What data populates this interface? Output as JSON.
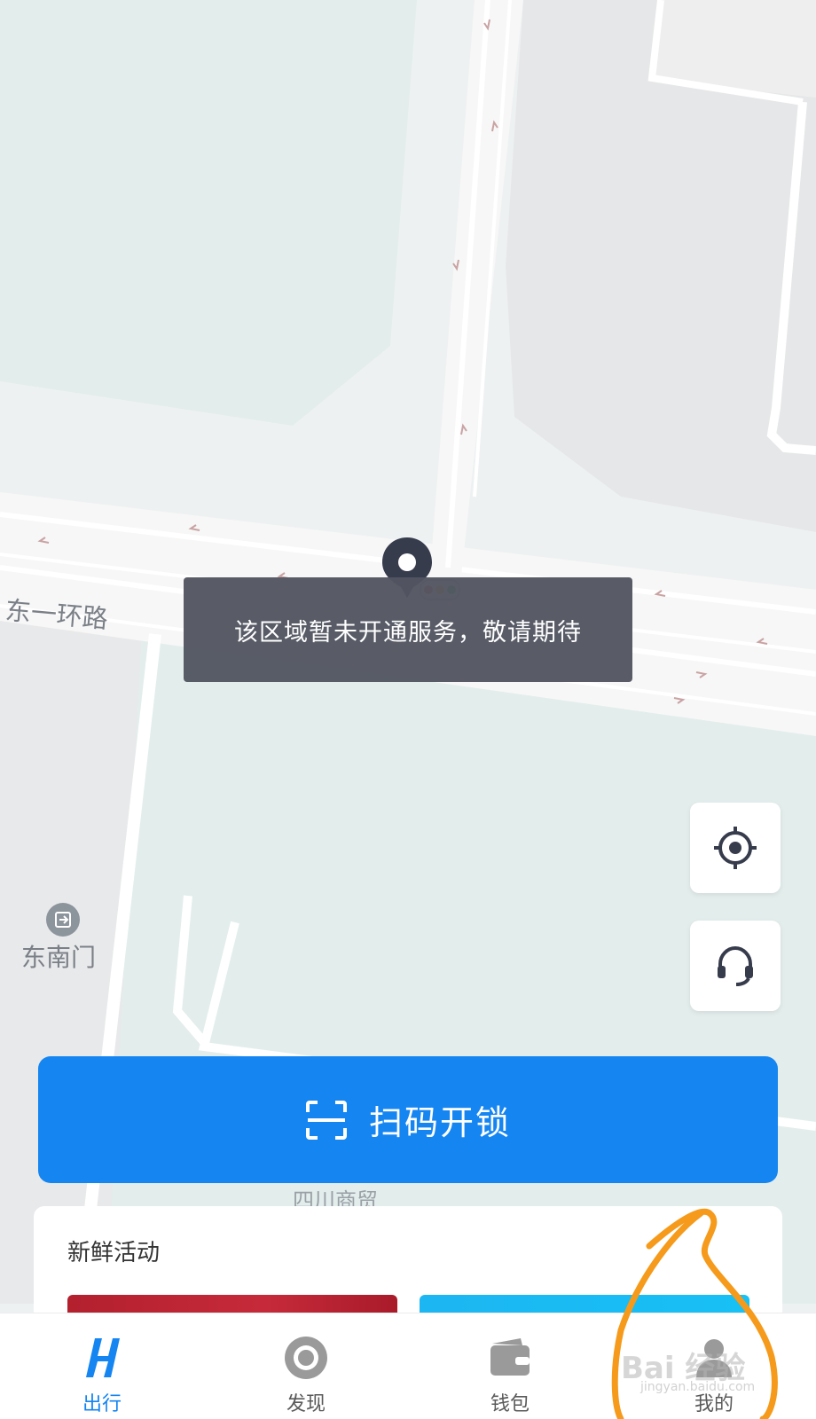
{
  "map": {
    "road_label": "东一环路",
    "poi_label": "东南门",
    "poi_icon": "exit-icon",
    "area_label": "四川商贸"
  },
  "toast": {
    "message": "该区域暂未开通服务，敬请期待"
  },
  "side_buttons": {
    "locate_icon": "crosshair-icon",
    "service_icon": "headset-icon"
  },
  "scan_button": {
    "label": "扫码开锁",
    "icon": "scan-frame-icon"
  },
  "activity": {
    "title": "新鲜活动"
  },
  "tabbar": {
    "items": [
      {
        "label": "出行",
        "icon": "hello-logo-icon",
        "active": true
      },
      {
        "label": "发现",
        "icon": "discover-icon",
        "active": false
      },
      {
        "label": "钱包",
        "icon": "wallet-icon",
        "active": false
      },
      {
        "label": "我的",
        "icon": "profile-icon",
        "active": false
      }
    ]
  },
  "watermark": {
    "text": "Bai 经验",
    "url_text": "jingyan.baidu.com"
  },
  "colors": {
    "primary": "#1585f2",
    "toast_bg": "#525561",
    "annotation": "#f59a1b"
  }
}
